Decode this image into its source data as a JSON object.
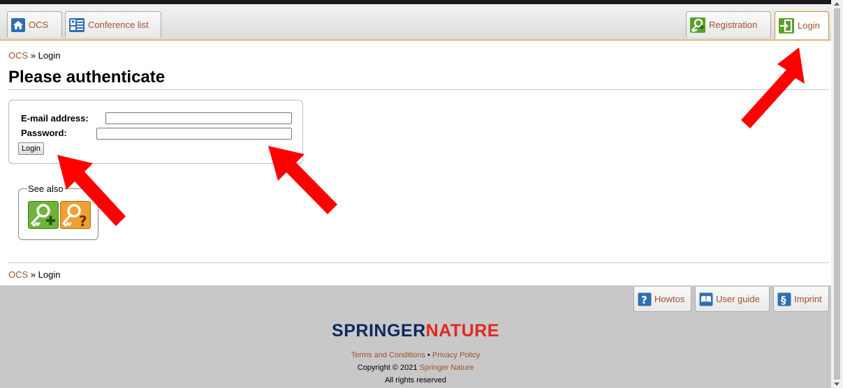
{
  "colors": {
    "link": "#a0522d",
    "accent": "#c8961e",
    "footer_bg": "#c8c8c8",
    "springer_blue": "#0a2a5e",
    "nature_red": "#e4261f",
    "arrow": "#ff0000"
  },
  "nav": {
    "left_tabs": [
      {
        "label": "OCS",
        "icon": "home-icon"
      },
      {
        "label": "Conference list",
        "icon": "conference-list-icon"
      }
    ],
    "right_tabs": [
      {
        "label": "Registration",
        "icon": "registration-key-icon"
      },
      {
        "label": "Login",
        "icon": "login-icon"
      }
    ]
  },
  "breadcrumb": {
    "root": "OCS",
    "separator": "»",
    "current": "Login"
  },
  "page_title": "Please authenticate",
  "login_form": {
    "email_label": "E-mail address:",
    "email_value": "",
    "password_label": "Password:",
    "password_value": "",
    "submit_label": "Login"
  },
  "see_also": {
    "legend": "See also",
    "items": [
      {
        "icon": "register-key-plus-icon"
      },
      {
        "icon": "forgot-password-key-icon"
      }
    ]
  },
  "footer": {
    "tabs": [
      {
        "label": "Howtos",
        "icon": "help-icon"
      },
      {
        "label": "User guide",
        "icon": "book-icon"
      },
      {
        "label": "Imprint",
        "icon": "paragraph-icon"
      }
    ],
    "logo_left": "SPRINGER",
    "logo_right": "NATURE",
    "terms": "Terms and Conditions",
    "bullet": "•",
    "privacy": "Privacy Policy",
    "copyright_prefix": "Copyright © 2021",
    "copyright_link": "Springer Nature",
    "rights": "All rights reserved"
  }
}
